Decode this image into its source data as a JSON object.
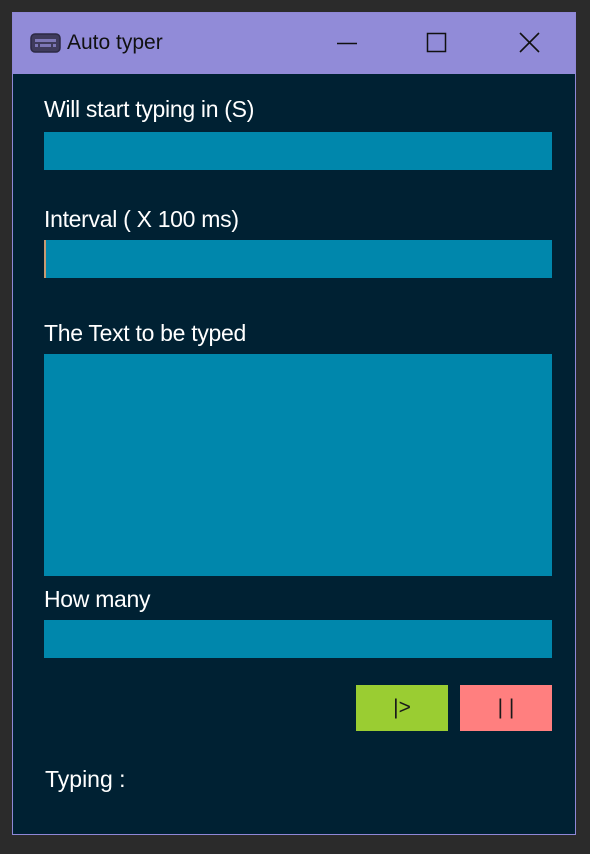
{
  "window": {
    "title": "Auto typer",
    "app_icon": "keyboard-icon",
    "controls": {
      "minimize_icon": "minimize-icon",
      "maximize_icon": "maximize-icon",
      "close_icon": "close-icon"
    }
  },
  "form": {
    "start_delay": {
      "label": "Will start typing in (S)",
      "value": ""
    },
    "interval": {
      "label": "Interval ( X 100 ms)",
      "value": ""
    },
    "text_to_type": {
      "label": "The Text to be typed",
      "value": ""
    },
    "how_many": {
      "label": "How many",
      "value": ""
    }
  },
  "buttons": {
    "start_label": "|>",
    "stop_label": "| |"
  },
  "status": {
    "text": "Typing :"
  },
  "colors": {
    "titlebar": "#918bd8",
    "background": "#002133",
    "input": "#0087ac",
    "start_button": "#9acd32",
    "stop_button": "#ff7f7f"
  }
}
